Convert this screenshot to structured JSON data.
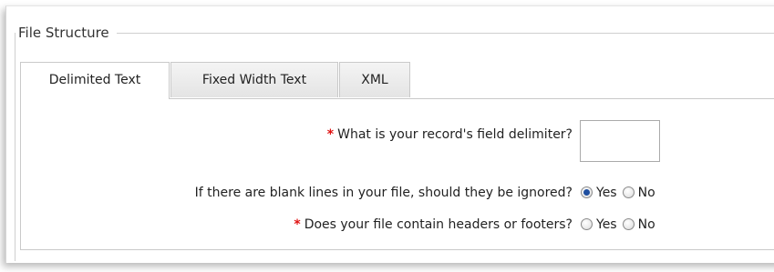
{
  "fieldset": {
    "legend": "File Structure"
  },
  "tabs": [
    {
      "label": "Delimited Text",
      "active": true
    },
    {
      "label": "Fixed Width Text",
      "active": false
    },
    {
      "label": "XML",
      "active": false
    }
  ],
  "form": {
    "delimiter": {
      "required_mark": "*",
      "question": "What is your record's field delimiter?",
      "value": ""
    },
    "blank_lines": {
      "question": "If there are blank lines in your file, should they be ignored?",
      "options": [
        "Yes",
        "No"
      ],
      "selected": "Yes"
    },
    "headers_footers": {
      "required_mark": "*",
      "question": "Does your file contain headers or footers?",
      "options": [
        "Yes",
        "No"
      ],
      "selected": ""
    }
  },
  "colors": {
    "required": "#e01010",
    "radio_selected": "#1f4fa0",
    "border": "#c9c9c9"
  }
}
